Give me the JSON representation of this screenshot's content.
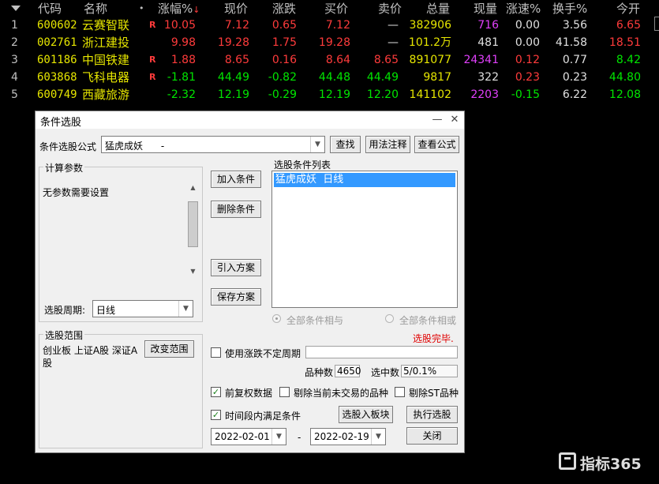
{
  "columns": {
    "code": "代码",
    "name": "名称",
    "dot": "•",
    "pct": "涨幅%",
    "sort_arrow": "↓",
    "price": "现价",
    "change": "涨跌",
    "bid": "买价",
    "ask": "卖价",
    "volume": "总量",
    "cur_vol": "现量",
    "speed": "涨速%",
    "turnover": "换手%",
    "open": "今开"
  },
  "rows": [
    {
      "idx": "1",
      "code": "600602",
      "name": "云赛智联",
      "badge": "R",
      "pct": "10.05",
      "price": "7.12",
      "change": "0.65",
      "bid": "7.12",
      "ask": "—",
      "volume": "382906",
      "cur_vol": "716",
      "speed": "0.00",
      "turnover": "3.56",
      "open": "6.65"
    },
    {
      "idx": "2",
      "code": "002761",
      "name": "浙江建投",
      "badge": "",
      "pct": "9.98",
      "price": "19.28",
      "change": "1.75",
      "bid": "19.28",
      "ask": "—",
      "volume": "101.2万",
      "cur_vol": "481",
      "speed": "0.00",
      "turnover": "41.58",
      "open": "18.51"
    },
    {
      "idx": "3",
      "code": "601186",
      "name": "中国铁建",
      "badge": "R",
      "pct": "1.88",
      "price": "8.65",
      "change": "0.16",
      "bid": "8.64",
      "ask": "8.65",
      "volume": "891077",
      "cur_vol": "24341",
      "speed": "0.12",
      "turnover": "0.77",
      "open": "8.42"
    },
    {
      "idx": "4",
      "code": "603868",
      "name": "飞科电器",
      "badge": "R",
      "pct": "-1.81",
      "price": "44.49",
      "change": "-0.82",
      "bid": "44.48",
      "ask": "44.49",
      "volume": "9817",
      "cur_vol": "322",
      "speed": "0.23",
      "turnover": "0.23",
      "open": "44.80"
    },
    {
      "idx": "5",
      "code": "600749",
      "name": "西藏旅游",
      "badge": "",
      "pct": "-2.32",
      "price": "12.19",
      "change": "-0.29",
      "bid": "12.19",
      "ask": "12.20",
      "volume": "141102",
      "cur_vol": "2203",
      "speed": "-0.15",
      "turnover": "6.22",
      "open": "12.08"
    }
  ],
  "colors": {
    "up": "#ff3b3b",
    "down": "#00e600",
    "code": "#e6e600",
    "magenta": "#e040fb"
  },
  "dialog": {
    "title": "条件选股",
    "minimize": "—",
    "close": "✕",
    "formula_label": "条件选股公式",
    "formula_value": "猛虎成妖      -",
    "find": "查找",
    "usage": "用法注释",
    "view_formula": "查看公式",
    "params_group": "计算参数",
    "params_text": "无参数需要设置",
    "period_label": "选股周期:",
    "period_value": "日线",
    "add_cond": "加入条件",
    "del_cond": "删除条件",
    "import_plan": "引入方案",
    "save_plan": "保存方案",
    "cond_list_label": "选股条件列表",
    "cond_item": "猛虎成妖  日线",
    "radio_and": "全部条件相与",
    "radio_or": "全部条件相或",
    "status": "选股完毕.",
    "range_group": "选股范围",
    "range_text": "创业板 上证A股 深证A股",
    "change_range": "改变范围",
    "use_var_period": "使用涨跌不定周期",
    "count_label": "品种数",
    "count_value": "4650",
    "selected_label": "选中数",
    "selected_value": "5/0.1%",
    "pre_adjust": "前复权数据",
    "remove_untraded": "剔除当前未交易的品种",
    "remove_st": "剔除ST品种",
    "to_block": "选股入板块",
    "time_range": "时间段内满足条件",
    "execute": "执行选股",
    "date_from": "2022-02-01",
    "date_sep": "-",
    "date_to": "2022-02-19",
    "close_btn": "关闭",
    "check_mark": "✓"
  },
  "watermark": {
    "text": "指标365"
  }
}
